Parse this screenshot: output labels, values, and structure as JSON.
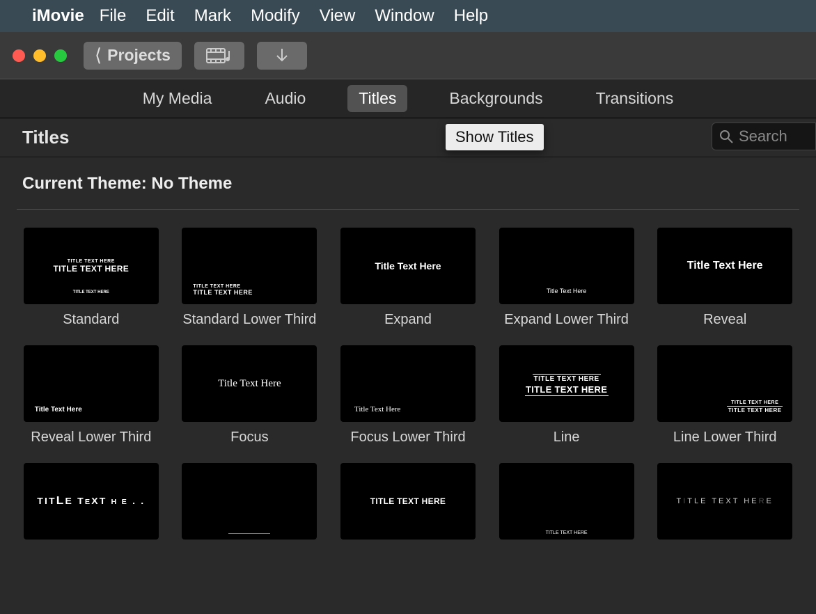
{
  "menubar": {
    "app": "iMovie",
    "items": [
      "File",
      "Edit",
      "Mark",
      "Modify",
      "View",
      "Window",
      "Help"
    ]
  },
  "traffic": {
    "close": "#ff5b53",
    "min": "#ffbd2b",
    "max": "#27c93f"
  },
  "toolbar": {
    "projects_label": "Projects"
  },
  "tabs": [
    {
      "label": "My Media",
      "active": false
    },
    {
      "label": "Audio",
      "active": false
    },
    {
      "label": "Titles",
      "active": true
    },
    {
      "label": "Backgrounds",
      "active": false
    },
    {
      "label": "Transitions",
      "active": false
    }
  ],
  "section": {
    "title": "Titles",
    "tooltip": "Show Titles",
    "search_placeholder": "Search"
  },
  "theme_label": "Current Theme: No Theme",
  "title_thumb_text": {
    "sub": "TITLE TEXT HERE",
    "main": "TITLE TEXT HERE",
    "mixed": "Title Text Here"
  },
  "titles": [
    {
      "name": "Standard",
      "style": "standard"
    },
    {
      "name": "Standard Lower Third",
      "style": "standard-low"
    },
    {
      "name": "Expand",
      "style": "expand"
    },
    {
      "name": "Expand Lower Third",
      "style": "expand-low"
    },
    {
      "name": "Reveal",
      "style": "reveal"
    },
    {
      "name": "Reveal Lower Third",
      "style": "reveal-low"
    },
    {
      "name": "Focus",
      "style": "focus"
    },
    {
      "name": "Focus Lower Third",
      "style": "focus-low"
    },
    {
      "name": "Line",
      "style": "line"
    },
    {
      "name": "Line Lower Third",
      "style": "line-low"
    },
    {
      "name": "",
      "style": "pop"
    },
    {
      "name": "",
      "style": "pop-low"
    },
    {
      "name": "",
      "style": "pull"
    },
    {
      "name": "",
      "style": "pull-low"
    },
    {
      "name": "",
      "style": "drift"
    }
  ]
}
